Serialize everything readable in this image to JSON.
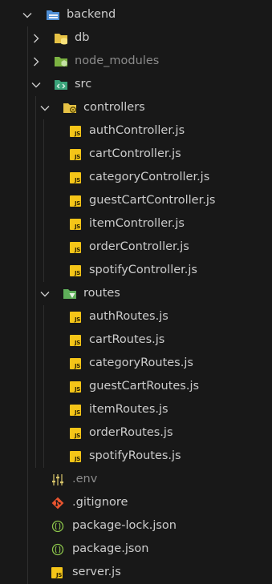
{
  "explorer": {
    "root": {
      "label": "backend",
      "icon": "folder-config-icon"
    },
    "db": {
      "label": "db",
      "icon": "folder-database-icon"
    },
    "node_modules": {
      "label": "node_modules",
      "icon": "folder-node-icon"
    },
    "src": {
      "label": "src",
      "icon": "folder-src-icon"
    },
    "controllers": {
      "label": "controllers",
      "icon": "folder-controllers-icon",
      "files": [
        "authController.js",
        "cartController.js",
        "categoryController.js",
        "guestCartController.js",
        "itemController.js",
        "orderController.js",
        "spotifyController.js"
      ]
    },
    "routes": {
      "label": "routes",
      "icon": "folder-routes-icon",
      "files": [
        "authRoutes.js",
        "cartRoutes.js",
        "categoryRoutes.js",
        "guestCartRoutes.js",
        "itemRoutes.js",
        "orderRoutes.js",
        "spotifyRoutes.js"
      ]
    },
    "root_files": {
      "env": ".env",
      "gitignore": ".gitignore",
      "package_lock": "package-lock.json",
      "package_json": "package.json",
      "server": "server.js"
    },
    "js_icon_text": "JS",
    "colors": {
      "background": "#181818",
      "text": "#cccccc",
      "dimmed_text": "#8b8b8b",
      "js_icon": "#f5c518",
      "git_icon": "#e8542f",
      "json_icon": "#8bc34a",
      "folder_blue": "#4f8fd6",
      "folder_yellow": "#e6c245",
      "folder_green": "#7cb342"
    }
  }
}
